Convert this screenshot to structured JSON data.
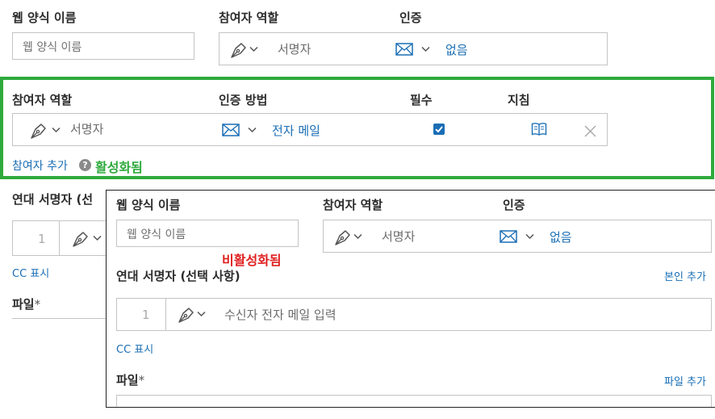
{
  "top": {
    "web_form_name_label": "웹 양식 이름",
    "web_form_name_placeholder": "웹 양식 이름",
    "participant_role_label": "참여자 역할",
    "participant_role_value": "서명자",
    "auth_label": "인증",
    "auth_value": "없음"
  },
  "active_panel": {
    "participant_role_label": "참여자 역할",
    "auth_method_label": "인증 방법",
    "required_label": "필수",
    "guide_label": "지침",
    "participant_role_value": "서명자",
    "auth_method_value": "전자 메일",
    "required_checked": true,
    "add_participant": "참여자 추가",
    "help_icon_glyph": "?",
    "status_label": "활성화됨",
    "border_color": "#2eaa3c"
  },
  "behind": {
    "cosigner_label": "연대 서명자 (선",
    "row_number": "1",
    "cc_show": "CC 표시",
    "file_label": "파일",
    "required_mark": "*"
  },
  "inactive_panel": {
    "web_form_name_label": "웹 양식 이름",
    "web_form_name_placeholder": "웹 양식 이름",
    "participant_role_label": "참여자 역할",
    "participant_role_value": "서명자",
    "auth_label": "인증",
    "auth_value": "없음",
    "status_label": "비활성화됨",
    "status_color": "#e02020",
    "cosigner_label": "연대 서명자 (선택 사항)",
    "add_self": "본인 추가",
    "row_number": "1",
    "recipient_placeholder": "수신자 전자 메일 입력",
    "cc_show": "CC 표시",
    "file_label": "파일",
    "required_mark": "*",
    "add_file": "파일 추가"
  },
  "icons": {
    "pen": "pen-nib-icon",
    "chevron": "chevron-down-icon",
    "mail": "envelope-icon",
    "book": "open-book-icon",
    "close": "close-x-icon",
    "help": "question-circle-icon",
    "check": "checkbox-checked-icon"
  }
}
